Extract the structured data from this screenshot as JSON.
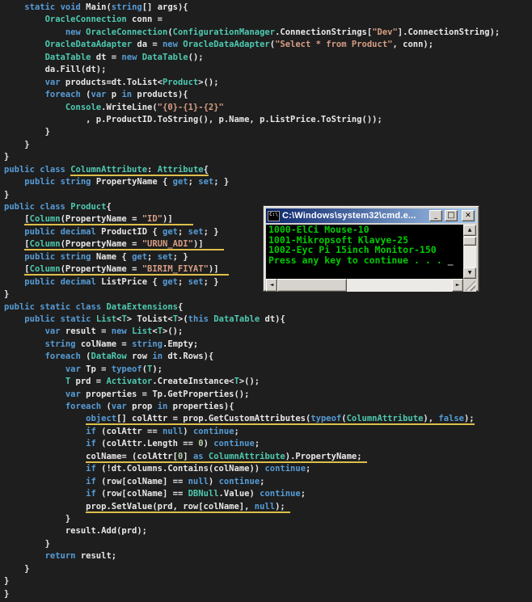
{
  "editor": {
    "background": "#1e1e1e",
    "colors": {
      "keyword": "#569cd6",
      "type": "#4ec9b0",
      "string": "#d69d85",
      "number": "#b5cea8",
      "default": "#e8e8e8",
      "underline": "#ddbf4a"
    },
    "lines": [
      [
        [
          "w",
          "    "
        ],
        [
          "k",
          "static"
        ],
        [
          "w",
          " "
        ],
        [
          "k",
          "void"
        ],
        [
          "w",
          " Main("
        ],
        [
          "k",
          "string"
        ],
        [
          "w",
          "[] args){"
        ]
      ],
      [
        [
          "w",
          "        "
        ],
        [
          "t",
          "OracleConnection"
        ],
        [
          "w",
          " conn ="
        ]
      ],
      [
        [
          "w",
          "            "
        ],
        [
          "k",
          "new"
        ],
        [
          "w",
          " "
        ],
        [
          "t",
          "OracleConnection"
        ],
        [
          "w",
          "("
        ],
        [
          "t",
          "ConfigurationManager"
        ],
        [
          "w",
          ".ConnectionStrings["
        ],
        [
          "s",
          "\"Dev\""
        ],
        [
          "w",
          "].ConnectionString);"
        ]
      ],
      [
        [
          "w",
          "        "
        ],
        [
          "t",
          "OracleDataAdapter"
        ],
        [
          "w",
          " da = "
        ],
        [
          "k",
          "new"
        ],
        [
          "w",
          " "
        ],
        [
          "t",
          "OracleDataAdapter"
        ],
        [
          "w",
          "("
        ],
        [
          "s",
          "\"Select * from Product\""
        ],
        [
          "w",
          ", conn);"
        ]
      ],
      [
        [
          "w",
          "        "
        ],
        [
          "t",
          "DataTable"
        ],
        [
          "w",
          " dt = "
        ],
        [
          "k",
          "new"
        ],
        [
          "w",
          " "
        ],
        [
          "t",
          "DataTable"
        ],
        [
          "w",
          "();"
        ]
      ],
      [
        [
          "w",
          "        da.Fill(dt);"
        ]
      ],
      [
        [
          "w",
          "        "
        ],
        [
          "k",
          "var"
        ],
        [
          "w",
          " products=dt.ToList<"
        ],
        [
          "t",
          "Product"
        ],
        [
          "w",
          ">();"
        ]
      ],
      [
        [
          "w",
          "        "
        ],
        [
          "k",
          "foreach"
        ],
        [
          "w",
          " ("
        ],
        [
          "k",
          "var"
        ],
        [
          "w",
          " p "
        ],
        [
          "k",
          "in"
        ],
        [
          "w",
          " products){"
        ]
      ],
      [
        [
          "w",
          "            "
        ],
        [
          "t",
          "Console"
        ],
        [
          "w",
          ".WriteLine("
        ],
        [
          "s",
          "\"{0}-{1}-{2}\""
        ]
      ],
      [
        [
          "w",
          "                , p.ProductID.ToString(), p.Name, p.ListPrice.ToString());"
        ]
      ],
      [
        [
          "w",
          "        }"
        ]
      ],
      [
        [
          "w",
          "    }"
        ]
      ],
      [
        [
          "w",
          "}"
        ]
      ],
      [
        [
          "k",
          "public"
        ],
        [
          "w",
          " "
        ],
        [
          "k",
          "class"
        ],
        [
          "w",
          " "
        ],
        [
          "t u",
          "ColumnAttribute"
        ],
        [
          "w u",
          ": "
        ],
        [
          "t u",
          "Attribute"
        ],
        [
          "w u",
          "{"
        ]
      ],
      [
        [
          "w",
          "    "
        ],
        [
          "k",
          "public"
        ],
        [
          "w",
          " "
        ],
        [
          "k",
          "string"
        ],
        [
          "w",
          " PropertyName { "
        ],
        [
          "k",
          "get"
        ],
        [
          "w",
          "; "
        ],
        [
          "k",
          "set"
        ],
        [
          "w",
          "; }"
        ]
      ],
      [
        [
          "w",
          "}"
        ]
      ],
      [
        [
          "k",
          "public"
        ],
        [
          "w",
          " "
        ],
        [
          "k",
          "class"
        ],
        [
          "w",
          " "
        ],
        [
          "t",
          "Product"
        ],
        [
          "w",
          "{"
        ]
      ],
      [
        [
          "w",
          "    "
        ],
        [
          "w u",
          "["
        ],
        [
          "t u",
          "Column"
        ],
        [
          "w u",
          "(PropertyName = "
        ],
        [
          "s u",
          "\"ID\""
        ],
        [
          "w u",
          ")]    "
        ]
      ],
      [
        [
          "w",
          "    "
        ],
        [
          "k",
          "public"
        ],
        [
          "w",
          " "
        ],
        [
          "k",
          "decimal"
        ],
        [
          "w",
          " ProductID { "
        ],
        [
          "k",
          "get"
        ],
        [
          "w",
          "; "
        ],
        [
          "k",
          "set"
        ],
        [
          "w",
          "; }"
        ]
      ],
      [
        [
          "w",
          "    "
        ],
        [
          "w u",
          "["
        ],
        [
          "t u",
          "Column"
        ],
        [
          "w u",
          "(PropertyName = "
        ],
        [
          "s u",
          "\"URUN_ADI\""
        ],
        [
          "w u",
          ")]    "
        ]
      ],
      [
        [
          "w",
          "    "
        ],
        [
          "k",
          "public"
        ],
        [
          "w",
          " "
        ],
        [
          "k",
          "string"
        ],
        [
          "w",
          " Name { "
        ],
        [
          "k",
          "get"
        ],
        [
          "w",
          "; "
        ],
        [
          "k",
          "set"
        ],
        [
          "w",
          "; }"
        ]
      ],
      [
        [
          "w",
          "    "
        ],
        [
          "w u",
          "["
        ],
        [
          "t u",
          "Column"
        ],
        [
          "w u",
          "(PropertyName = "
        ],
        [
          "s u",
          "\"BIRIM_FIYAT\""
        ],
        [
          "w u",
          ")]  "
        ]
      ],
      [
        [
          "w",
          "    "
        ],
        [
          "k",
          "public"
        ],
        [
          "w",
          " "
        ],
        [
          "k",
          "decimal"
        ],
        [
          "w",
          " ListPrice { "
        ],
        [
          "k",
          "get"
        ],
        [
          "w",
          "; "
        ],
        [
          "k",
          "set"
        ],
        [
          "w",
          "; }"
        ]
      ],
      [
        [
          "w",
          "}"
        ]
      ],
      [
        [
          "k",
          "public"
        ],
        [
          "w",
          " "
        ],
        [
          "k",
          "static"
        ],
        [
          "w",
          " "
        ],
        [
          "k",
          "class"
        ],
        [
          "w",
          " "
        ],
        [
          "t",
          "DataExtensions"
        ],
        [
          "w",
          "{"
        ]
      ],
      [
        [
          "w",
          "    "
        ],
        [
          "k",
          "public"
        ],
        [
          "w",
          " "
        ],
        [
          "k",
          "static"
        ],
        [
          "w",
          " "
        ],
        [
          "t",
          "List"
        ],
        [
          "w",
          "<"
        ],
        [
          "t",
          "T"
        ],
        [
          "w",
          "> ToList<"
        ],
        [
          "t",
          "T"
        ],
        [
          "w",
          ">("
        ],
        [
          "k",
          "this"
        ],
        [
          "w",
          " "
        ],
        [
          "t",
          "DataTable"
        ],
        [
          "w",
          " dt){"
        ]
      ],
      [
        [
          "w",
          "        "
        ],
        [
          "k",
          "var"
        ],
        [
          "w",
          " result = "
        ],
        [
          "k",
          "new"
        ],
        [
          "w",
          " "
        ],
        [
          "t",
          "List"
        ],
        [
          "w",
          "<"
        ],
        [
          "t",
          "T"
        ],
        [
          "w",
          ">();"
        ]
      ],
      [
        [
          "w",
          "        "
        ],
        [
          "k",
          "string"
        ],
        [
          "w",
          " colName = "
        ],
        [
          "k",
          "string"
        ],
        [
          "w",
          ".Empty;"
        ]
      ],
      [
        [
          "w",
          "        "
        ],
        [
          "k",
          "foreach"
        ],
        [
          "w",
          " ("
        ],
        [
          "t",
          "DataRow"
        ],
        [
          "w",
          " row "
        ],
        [
          "k",
          "in"
        ],
        [
          "w",
          " dt.Rows){"
        ]
      ],
      [
        [
          "w",
          "            "
        ],
        [
          "k",
          "var"
        ],
        [
          "w",
          " Tp = "
        ],
        [
          "k",
          "typeof"
        ],
        [
          "w",
          "("
        ],
        [
          "t",
          "T"
        ],
        [
          "w",
          ");"
        ]
      ],
      [
        [
          "w",
          "            "
        ],
        [
          "t",
          "T"
        ],
        [
          "w",
          " prd = "
        ],
        [
          "t",
          "Activator"
        ],
        [
          "w",
          ".CreateInstance<"
        ],
        [
          "t",
          "T"
        ],
        [
          "w",
          ">();"
        ]
      ],
      [
        [
          "w",
          "            "
        ],
        [
          "k",
          "var"
        ],
        [
          "w",
          " properties = Tp.GetProperties();"
        ]
      ],
      [
        [
          "w",
          "            "
        ],
        [
          "k",
          "foreach"
        ],
        [
          "w",
          " ("
        ],
        [
          "k",
          "var"
        ],
        [
          "w",
          " prop "
        ],
        [
          "k",
          "in"
        ],
        [
          "w",
          " properties){"
        ]
      ],
      [
        [
          "w",
          "                "
        ],
        [
          "k u",
          "object"
        ],
        [
          "w u",
          "[] colAttr = prop.GetCustomAttributes("
        ],
        [
          "k u",
          "typeof"
        ],
        [
          "w u",
          "("
        ],
        [
          "t u",
          "ColumnAttribute"
        ],
        [
          "w u",
          "), "
        ],
        [
          "k u",
          "false"
        ],
        [
          "w u",
          ");"
        ]
      ],
      [
        [
          "w",
          "                "
        ],
        [
          "k",
          "if"
        ],
        [
          "w",
          " (colAttr == "
        ],
        [
          "k",
          "null"
        ],
        [
          "w",
          ") "
        ],
        [
          "k",
          "continue"
        ],
        [
          "w",
          ";"
        ]
      ],
      [
        [
          "w",
          "                "
        ],
        [
          "k",
          "if"
        ],
        [
          "w",
          " (colAttr.Length == "
        ],
        [
          "n",
          "0"
        ],
        [
          "w",
          ") "
        ],
        [
          "k",
          "continue"
        ],
        [
          "w",
          ";"
        ]
      ],
      [
        [
          "w",
          "                "
        ],
        [
          "w u",
          "colName= (colAttr["
        ],
        [
          "n u",
          "0"
        ],
        [
          "w u",
          "] "
        ],
        [
          "k u",
          "as"
        ],
        [
          "w u",
          " "
        ],
        [
          "t u",
          "ColumnAttribute"
        ],
        [
          "w u",
          ").PropertyName; "
        ]
      ],
      [
        [
          "w",
          "                "
        ],
        [
          "k",
          "if"
        ],
        [
          "w",
          " (!dt.Columns.Contains(colName)) "
        ],
        [
          "k",
          "continue"
        ],
        [
          "w",
          ";"
        ]
      ],
      [
        [
          "w",
          "                "
        ],
        [
          "k",
          "if"
        ],
        [
          "w",
          " (row[colName] == "
        ],
        [
          "k",
          "null"
        ],
        [
          "w",
          ") "
        ],
        [
          "k",
          "continue"
        ],
        [
          "w",
          ";"
        ]
      ],
      [
        [
          "w",
          "                "
        ],
        [
          "k",
          "if"
        ],
        [
          "w",
          " (row[colName] == "
        ],
        [
          "t",
          "DBNull"
        ],
        [
          "w",
          ".Value) "
        ],
        [
          "k",
          "continue"
        ],
        [
          "w",
          ";"
        ]
      ],
      [
        [
          "w",
          "                "
        ],
        [
          "w u",
          "prop.SetValue(prd, row[colName], "
        ],
        [
          "k u",
          "null"
        ],
        [
          "w u",
          "); "
        ]
      ],
      [
        [
          "w",
          "            }"
        ]
      ],
      [
        [
          "w",
          "            result.Add(prd);"
        ]
      ],
      [
        [
          "w",
          "        }"
        ]
      ],
      [
        [
          "w",
          "        "
        ],
        [
          "k",
          "return"
        ],
        [
          "w",
          " result;"
        ]
      ],
      [
        [
          "w",
          "    }"
        ]
      ],
      [
        [
          "w",
          "}"
        ]
      ],
      [
        [
          "w",
          "}"
        ]
      ]
    ]
  },
  "cmd_window": {
    "title": "C:\\Windows\\system32\\cmd.e...",
    "icon_glyph": "C:\\",
    "window_buttons": [
      {
        "name": "minimize",
        "glyph": "_"
      },
      {
        "name": "maximize",
        "glyph": "□"
      },
      {
        "name": "close",
        "glyph": "✕"
      }
    ],
    "console": {
      "lines": [
        "1000-ElCi Mouse-10",
        "1001-Mikropsoft Klavye-25",
        "1002-Eyc Pi 15inch Monitor-150",
        "Press any key to continue . . . "
      ],
      "cursor": "_",
      "text_color": "#00cc00",
      "background": "#000000"
    },
    "scrollbar": {
      "up": "▲",
      "down": "▼",
      "left": "◄",
      "right": "►"
    },
    "chrome_color": "#d6d3ce",
    "titlebar_gradient": [
      "#0a246a",
      "#a6caf0"
    ]
  }
}
